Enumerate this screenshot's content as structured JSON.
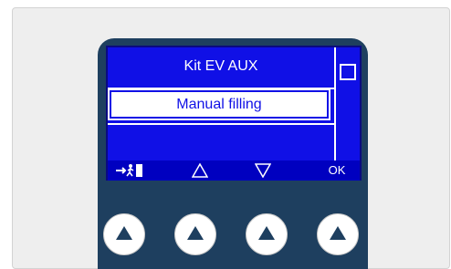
{
  "screen": {
    "title": "Kit EV AUX",
    "selected_item": "Manual filling"
  },
  "softkeys": {
    "exit_label": "→🚪",
    "up_icon": "triangle-up-outline-icon",
    "down_icon": "triangle-down-outline-icon",
    "ok_label": "OK"
  },
  "hardware_buttons": [
    {
      "icon": "triangle-up-filled-icon"
    },
    {
      "icon": "triangle-up-filled-icon"
    },
    {
      "icon": "triangle-up-filled-icon"
    },
    {
      "icon": "triangle-up-filled-icon"
    }
  ],
  "colors": {
    "lcd_background": "#1010e6",
    "device_body": "#1e3f5f",
    "softkey_bar": "#0000c0"
  }
}
